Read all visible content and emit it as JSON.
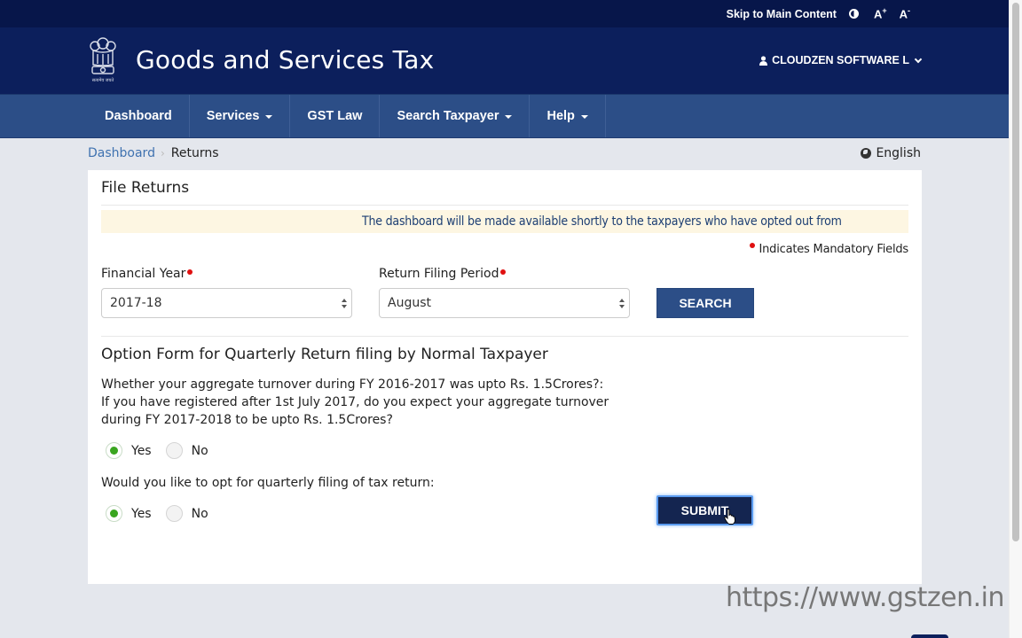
{
  "topbar": {
    "skip_link": "Skip to Main Content",
    "contrast_icon": "contrast-icon",
    "increase_font": "A",
    "increase_font_sup": "+",
    "decrease_font": "A",
    "decrease_font_sup": "-"
  },
  "header": {
    "emblem_icon": "national-emblem-icon",
    "title": "Goods and Services Tax",
    "user_icon": "user-icon",
    "user_name": "CLOUDZEN SOFTWARE L"
  },
  "nav": {
    "items": [
      {
        "label": "Dashboard",
        "dropdown": false
      },
      {
        "label": "Services",
        "dropdown": true
      },
      {
        "label": "GST Law",
        "dropdown": false
      },
      {
        "label": "Search Taxpayer",
        "dropdown": true
      },
      {
        "label": "Help",
        "dropdown": true
      }
    ]
  },
  "breadcrumb": {
    "items": [
      "Dashboard",
      "Returns"
    ],
    "separator": "›"
  },
  "language": {
    "icon": "globe-icon",
    "label": "English"
  },
  "panel": {
    "title": "File Returns",
    "notice": "The dashboard will be made available shortly to the taxpayers who have opted out from",
    "mandatory_note": "Indicates Mandatory Fields",
    "financial_year": {
      "label": "Financial Year",
      "value": "2017-18"
    },
    "return_period": {
      "label": "Return Filing Period",
      "value": "August"
    },
    "search_label": "SEARCH",
    "option_form": {
      "title": "Option Form for Quarterly Return filing by Normal Taxpayer",
      "question1": [
        "Whether your aggregate turnover during FY 2016-2017 was upto Rs. 1.5Crores?:",
        "If you have registered after 1st July 2017, do you expect your aggregate turnover",
        "during FY 2017-2018 to be upto Rs. 1.5Crores?"
      ],
      "question1_options": [
        {
          "label": "Yes",
          "selected": true
        },
        {
          "label": "No",
          "selected": false
        }
      ],
      "question2": "Would you like to opt for quarterly filing of tax return:",
      "question2_options": [
        {
          "label": "Yes",
          "selected": true
        },
        {
          "label": "No",
          "selected": false
        }
      ]
    },
    "submit_label": "SUBMIT"
  },
  "watermark": "https://www.gstzen.in",
  "colors": {
    "topbar": "#07164a",
    "header": "#0c1f5c",
    "nav": "#2c4e87",
    "page_bg": "#e4e7ed",
    "notice_bg": "#fdf6e2",
    "notice_text": "#1d3f73",
    "radio_selected": "#3aa520",
    "mandatory_dot": "#e01010",
    "submit_bg": "#142550"
  }
}
